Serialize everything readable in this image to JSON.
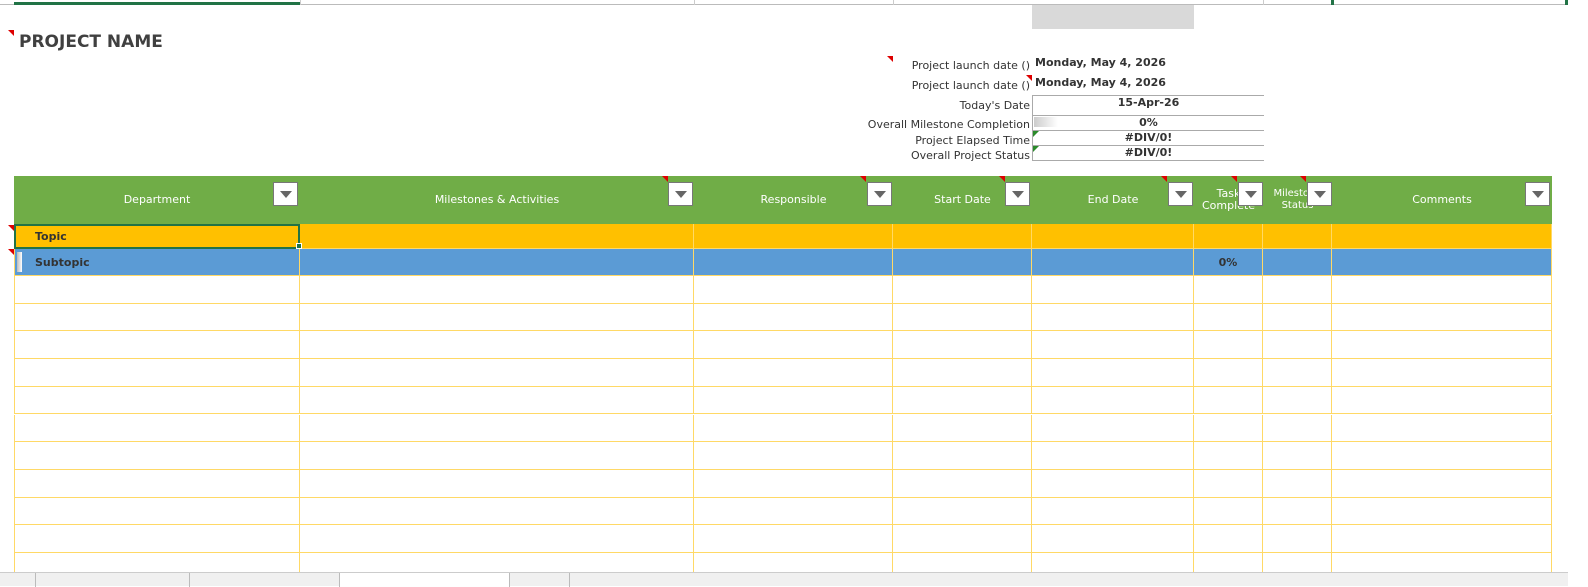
{
  "project": {
    "title": "PROJECT NAME"
  },
  "summary": [
    {
      "label": "Project launch date ()",
      "value": "Monday, May 4, 2026"
    },
    {
      "label": "Project launch date ()",
      "value": "Monday, May 4, 2026"
    },
    {
      "label": "Today's Date",
      "value": "15-Apr-26"
    },
    {
      "label": "Overall Milestone Completion",
      "value": "0%",
      "progress": 0
    },
    {
      "label": "Project Elapsed Time",
      "value": "#DIV/0!"
    },
    {
      "label": "Overall Project Status",
      "value": "#DIV/0!"
    }
  ],
  "columns": [
    "Department",
    "Milestones & Activities",
    "Responsible",
    "Start Date",
    "End Date",
    "Task Complete",
    "Milestone Status",
    "Comments"
  ],
  "rows": [
    {
      "type": "topic",
      "department": "Topic"
    },
    {
      "type": "subtopic",
      "department": "Subtopic",
      "task_complete": "0%",
      "progress": 0
    }
  ],
  "colors": {
    "header": "#70ad47",
    "topic": "#ffc000",
    "subtopic": "#5b9bd5",
    "grid": "#ffd966"
  }
}
